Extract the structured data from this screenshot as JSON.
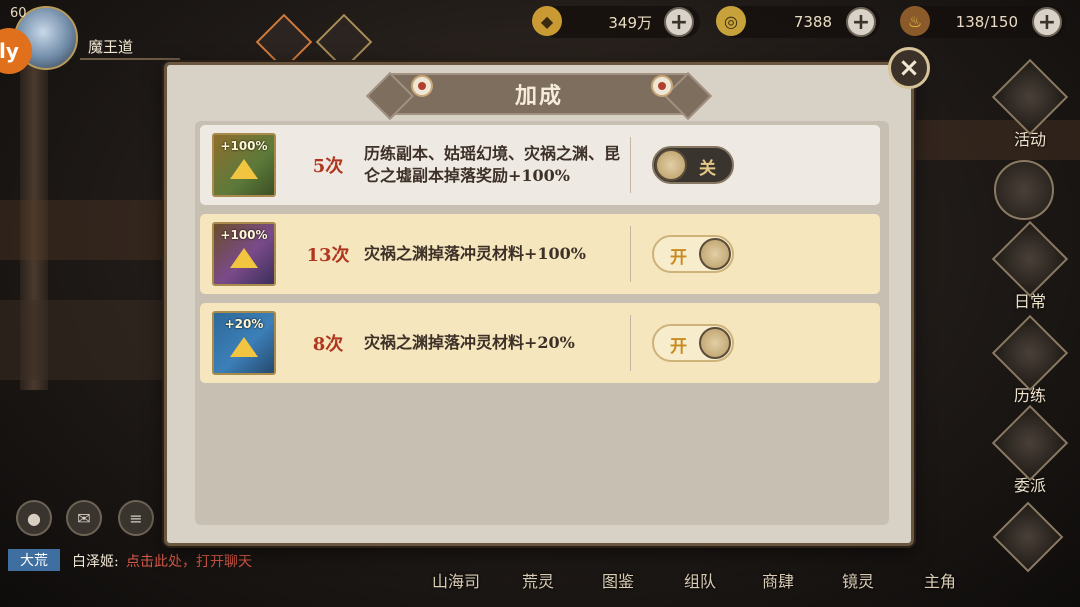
{
  "player": {
    "level": "60",
    "name": "魔王道",
    "badge": "ly"
  },
  "resources": [
    {
      "value": "349万",
      "icon": "coin-icon"
    },
    {
      "value": "7388",
      "icon": "gold-ring-icon"
    },
    {
      "value": "138/150",
      "icon": "stamina-gourd-icon"
    }
  ],
  "right_nav": [
    "活动",
    "日常",
    "历练",
    "委派"
  ],
  "bottom_nav": [
    "山海司",
    "荒灵",
    "图鉴",
    "组队",
    "商肆",
    "镜灵",
    "主角"
  ],
  "chat": {
    "channel": "大荒",
    "speaker": "白泽姬:",
    "text": "点击此处，打开聊天"
  },
  "dialog": {
    "title": "加成",
    "close_label": "×",
    "rows": [
      {
        "icon_text": "+100%",
        "count": "5次",
        "desc": "历练副本、姑瑶幻境、灾祸之渊、昆仑之墟副本掉落奖励+100%",
        "toggle": "关",
        "enabled": false
      },
      {
        "icon_text": "+100%",
        "count": "13次",
        "desc": "灾祸之渊掉落冲灵材料+100%",
        "toggle": "开",
        "enabled": true
      },
      {
        "icon_text": "+20%",
        "count": "8次",
        "desc": "灾祸之渊掉落冲灵材料+20%",
        "toggle": "开",
        "enabled": true
      }
    ]
  },
  "colors": {
    "count_red": "#b0361f",
    "row_on": "#f5e6be",
    "row_off": "#eeeae3",
    "chat_tag": "#3f6fa0"
  }
}
